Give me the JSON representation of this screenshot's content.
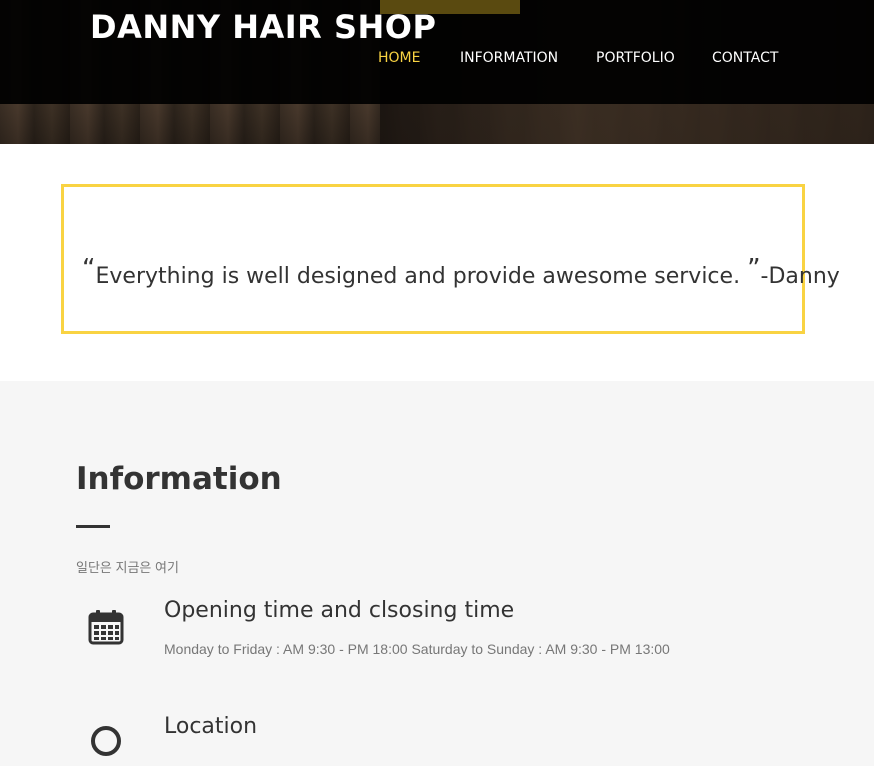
{
  "header": {
    "logo": "DANNY HAIR SHOP",
    "nav": [
      {
        "label": "HOME",
        "active": true
      },
      {
        "label": "INFORMATION",
        "active": false
      },
      {
        "label": "PORTFOLIO",
        "active": false
      },
      {
        "label": "CONTACT",
        "active": false
      }
    ]
  },
  "quote": {
    "open_mark": "“",
    "text": "Everything is well designed and provide awesome service.",
    "close_mark": "”",
    "author": "-Danny"
  },
  "information": {
    "title": "Information",
    "subtitle": "일단은 지금은 여기",
    "items": [
      {
        "icon": "calendar-icon",
        "title": "Opening time and clsosing time",
        "desc": "Monday to Friday : AM 9:30 - PM 18:00 Saturday to Sunday : AM 9:30 - PM 13:00"
      },
      {
        "icon": "location-icon",
        "title": "Location",
        "desc": ""
      }
    ]
  },
  "colors": {
    "accent": "#f9d342",
    "text": "#333333",
    "muted": "#777777"
  }
}
